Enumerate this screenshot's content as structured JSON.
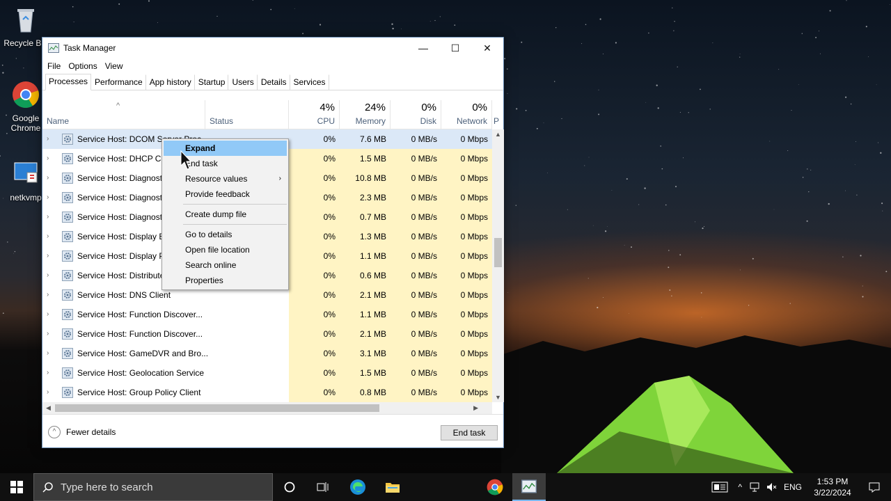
{
  "desktop": {
    "icons": [
      {
        "label": "Recycle Bin",
        "icon": "recycle-bin-icon"
      },
      {
        "label": "Google Chrome",
        "icon": "chrome-icon"
      },
      {
        "label": "netkvmp",
        "icon": "netkvm-icon"
      }
    ]
  },
  "window": {
    "title": "Task Manager",
    "controls": {
      "minimize": "—",
      "maximize": "☐",
      "close": "✕"
    },
    "menu": [
      "File",
      "Options",
      "View"
    ],
    "tabs": [
      "Processes",
      "Performance",
      "App history",
      "Startup",
      "Users",
      "Details",
      "Services"
    ],
    "active_tab": "Processes",
    "columns": {
      "name": "Name",
      "status": "Status",
      "cpu": {
        "pct": "4%",
        "label": "CPU"
      },
      "memory": {
        "pct": "24%",
        "label": "Memory"
      },
      "disk": {
        "pct": "0%",
        "label": "Disk"
      },
      "network": {
        "pct": "0%",
        "label": "Network"
      },
      "extra": "P"
    },
    "rows": [
      {
        "name": "Service Host: DCOM Server Proc...",
        "cpu": "0%",
        "memory": "7.6 MB",
        "disk": "0 MB/s",
        "network": "0 Mbps"
      },
      {
        "name": "Service Host: DHCP Client",
        "cpu": "0%",
        "memory": "1.5 MB",
        "disk": "0 MB/s",
        "network": "0 Mbps"
      },
      {
        "name": "Service Host: Diagnostic Policy...",
        "cpu": "0%",
        "memory": "10.8 MB",
        "disk": "0 MB/s",
        "network": "0 Mbps"
      },
      {
        "name": "Service Host: Diagnostic Servi...",
        "cpu": "0%",
        "memory": "2.3 MB",
        "disk": "0 MB/s",
        "network": "0 Mbps"
      },
      {
        "name": "Service Host: Diagnostic Syste...",
        "cpu": "0%",
        "memory": "0.7 MB",
        "disk": "0 MB/s",
        "network": "0 Mbps"
      },
      {
        "name": "Service Host: Display Enhance...",
        "cpu": "0%",
        "memory": "1.3 MB",
        "disk": "0 MB/s",
        "network": "0 Mbps"
      },
      {
        "name": "Service Host: Display Policy S...",
        "cpu": "0%",
        "memory": "1.1 MB",
        "disk": "0 MB/s",
        "network": "0 Mbps"
      },
      {
        "name": "Service Host: Distributed Link...",
        "cpu": "0%",
        "memory": "0.6 MB",
        "disk": "0 MB/s",
        "network": "0 Mbps"
      },
      {
        "name": "Service Host: DNS Client",
        "cpu": "0%",
        "memory": "2.1 MB",
        "disk": "0 MB/s",
        "network": "0 Mbps"
      },
      {
        "name": "Service Host: Function Discover...",
        "cpu": "0%",
        "memory": "1.1 MB",
        "disk": "0 MB/s",
        "network": "0 Mbps"
      },
      {
        "name": "Service Host: Function Discover...",
        "cpu": "0%",
        "memory": "2.1 MB",
        "disk": "0 MB/s",
        "network": "0 Mbps"
      },
      {
        "name": "Service Host: GameDVR and Bro...",
        "cpu": "0%",
        "memory": "3.1 MB",
        "disk": "0 MB/s",
        "network": "0 Mbps"
      },
      {
        "name": "Service Host: Geolocation Service",
        "cpu": "0%",
        "memory": "1.5 MB",
        "disk": "0 MB/s",
        "network": "0 Mbps"
      },
      {
        "name": "Service Host: Group Policy Client",
        "cpu": "0%",
        "memory": "0.8 MB",
        "disk": "0 MB/s",
        "network": "0 Mbps"
      }
    ],
    "footer": {
      "fewer_details": "Fewer details",
      "end_task": "End task"
    }
  },
  "context_menu": {
    "groups": [
      [
        "Expand",
        "End task",
        "Resource values",
        "Provide feedback"
      ],
      [
        "Create dump file"
      ],
      [
        "Go to details",
        "Open file location",
        "Search online",
        "Properties"
      ]
    ],
    "highlighted": "Expand",
    "submenu_item": "Resource values"
  },
  "taskbar": {
    "search_placeholder": "Type here to search",
    "language": "ENG",
    "time": "1:53 PM",
    "date": "3/22/2024",
    "colors": {
      "accent": "#79b8f0",
      "background": "#101010"
    }
  }
}
